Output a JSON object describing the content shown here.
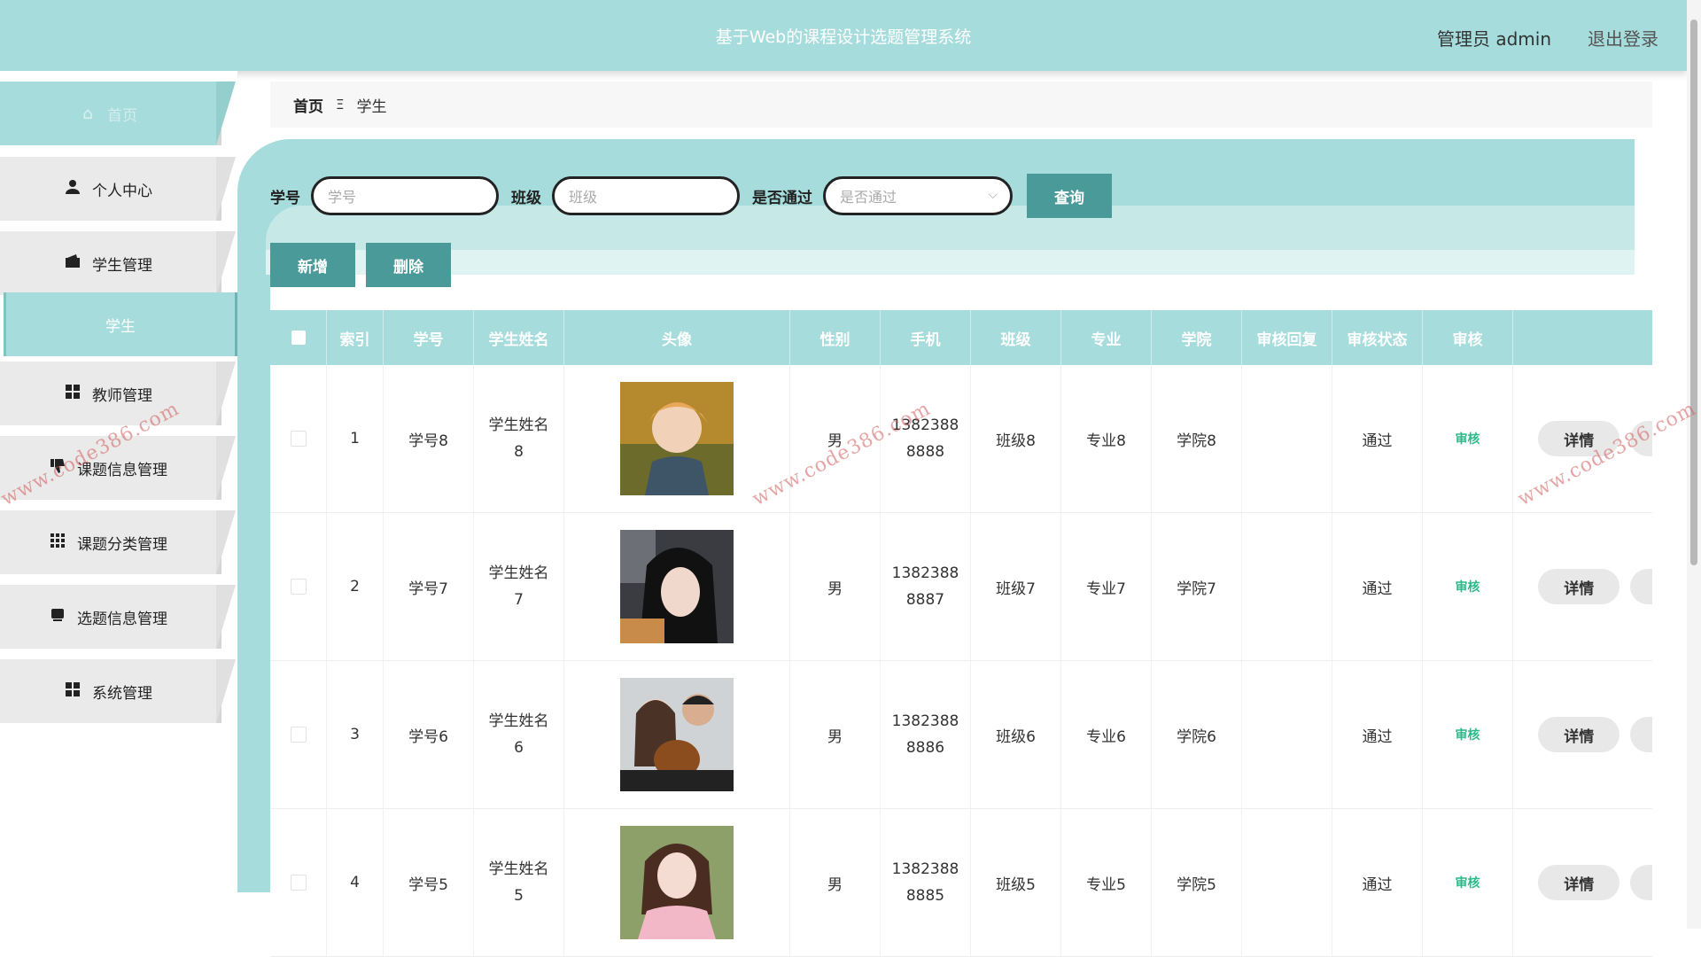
{
  "header": {
    "title": "基于Web的课程设计选题管理系统",
    "user": "管理员 admin",
    "logout": "退出登录"
  },
  "sidebar": {
    "items": [
      {
        "label": "首页",
        "icon": "home-icon"
      },
      {
        "label": "个人中心",
        "icon": "user-icon"
      },
      {
        "label": "学生管理",
        "icon": "wallet-icon"
      },
      {
        "label": "学生",
        "icon": ""
      },
      {
        "label": "教师管理",
        "icon": "grid-icon"
      },
      {
        "label": "课题信息管理",
        "icon": "thumbs-down-icon"
      },
      {
        "label": "课题分类管理",
        "icon": "apps-icon"
      },
      {
        "label": "选题信息管理",
        "icon": "inbox-icon"
      },
      {
        "label": "系统管理",
        "icon": "grid-icon"
      }
    ]
  },
  "breadcrumb": {
    "home": "首页",
    "sep": "Ξ",
    "current": "学生"
  },
  "search": {
    "id_label": "学号",
    "id_placeholder": "学号",
    "class_label": "班级",
    "class_placeholder": "班级",
    "pass_label": "是否通过",
    "pass_placeholder": "是否通过",
    "query": "查询"
  },
  "actions": {
    "add": "新增",
    "delete": "删除"
  },
  "table": {
    "columns": [
      "索引",
      "学号",
      "学生姓名",
      "头像",
      "性别",
      "手机",
      "班级",
      "专业",
      "学院",
      "审核回复",
      "审核状态",
      "审核"
    ],
    "rows": [
      {
        "index": "1",
        "id": "学号8",
        "name1": "学生姓名",
        "name2": "8",
        "gender": "男",
        "phone1": "1382388",
        "phone2": "8888",
        "class": "班级8",
        "major": "专业8",
        "college": "学院8",
        "reply": "",
        "status": "通过",
        "audit": "审核",
        "detail": "详情"
      },
      {
        "index": "2",
        "id": "学号7",
        "name1": "学生姓名",
        "name2": "7",
        "gender": "男",
        "phone1": "1382388",
        "phone2": "8887",
        "class": "班级7",
        "major": "专业7",
        "college": "学院7",
        "reply": "",
        "status": "通过",
        "audit": "审核",
        "detail": "详情"
      },
      {
        "index": "3",
        "id": "学号6",
        "name1": "学生姓名",
        "name2": "6",
        "gender": "男",
        "phone1": "1382388",
        "phone2": "8886",
        "class": "班级6",
        "major": "专业6",
        "college": "学院6",
        "reply": "",
        "status": "通过",
        "audit": "审核",
        "detail": "详情"
      },
      {
        "index": "4",
        "id": "学号5",
        "name1": "学生姓名",
        "name2": "5",
        "gender": "男",
        "phone1": "1382388",
        "phone2": "8885",
        "class": "班级5",
        "major": "专业5",
        "college": "学院5",
        "reply": "",
        "status": "通过",
        "audit": "审核",
        "detail": "详情"
      }
    ]
  },
  "watermark": "www.code386.com",
  "colors": {
    "teal": "#a6dcdb",
    "button": "#4b9a9a",
    "audit": "#2cb98a"
  }
}
